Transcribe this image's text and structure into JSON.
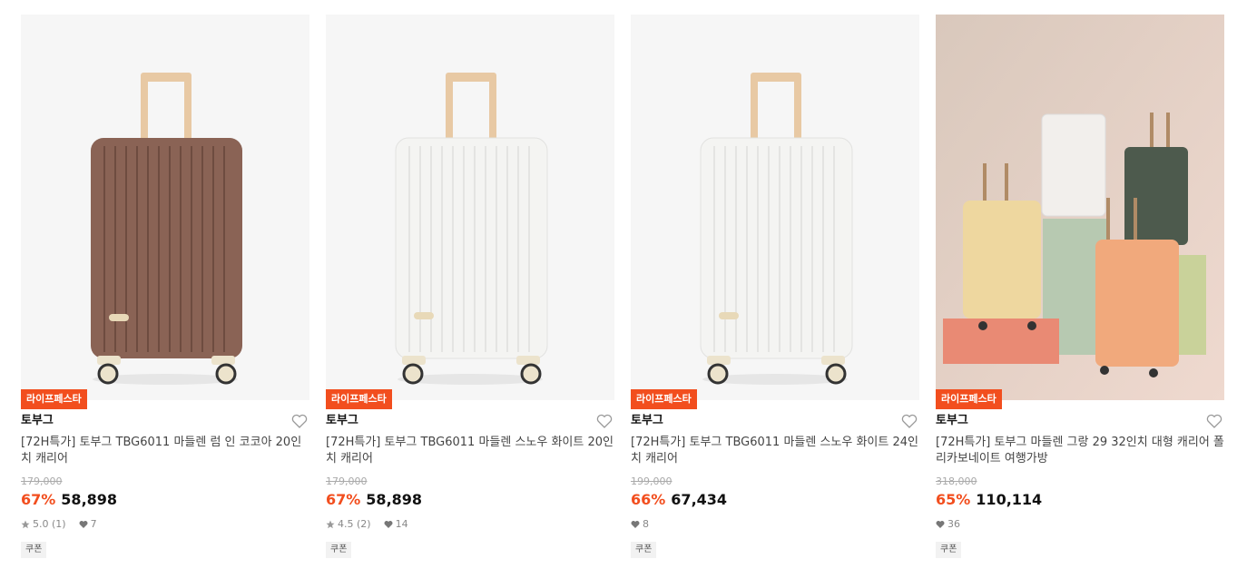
{
  "products": [
    {
      "badge": "라이프페스타",
      "brand": "토부그",
      "title": "[72H특가] 토부그 TBG6011 마들렌 럼 인 코코아 20인치 캐리어",
      "original_price": "179,000",
      "discount": "67%",
      "price": "58,898",
      "rating": "5.0 (1)",
      "likes": "7",
      "coupon": "쿠폰",
      "image": "brown-suitcase",
      "body_color": "#8a6355"
    },
    {
      "badge": "라이프페스타",
      "brand": "토부그",
      "title": "[72H특가] 토부그 TBG6011 마들렌 스노우 화이트 20인치 캐리어",
      "original_price": "179,000",
      "discount": "67%",
      "price": "58,898",
      "rating": "4.5 (2)",
      "likes": "14",
      "coupon": "쿠폰",
      "image": "white-suitcase",
      "body_color": "#f4f4f2"
    },
    {
      "badge": "라이프페스타",
      "brand": "토부그",
      "title": "[72H특가] 토부그 TBG6011 마들렌 스노우 화이트 24인치 캐리어",
      "original_price": "199,000",
      "discount": "66%",
      "price": "67,434",
      "rating": "",
      "likes": "8",
      "coupon": "쿠폰",
      "image": "white-suitcase",
      "body_color": "#f4f4f2"
    },
    {
      "badge": "라이프페스타",
      "brand": "토부그",
      "title": "[72H특가] 토부그 마들렌 그랑 29 32인치 대형 캐리어 폴리카보네이트 여행가방",
      "original_price": "318,000",
      "discount": "65%",
      "price": "110,114",
      "rating": "",
      "likes": "36",
      "coupon": "쿠폰",
      "image": "suitcase-collection-scene"
    }
  ],
  "colors": {
    "accent": "#f24e1e",
    "handle": "#e8c9a4",
    "wheel": "#ece3cc"
  }
}
